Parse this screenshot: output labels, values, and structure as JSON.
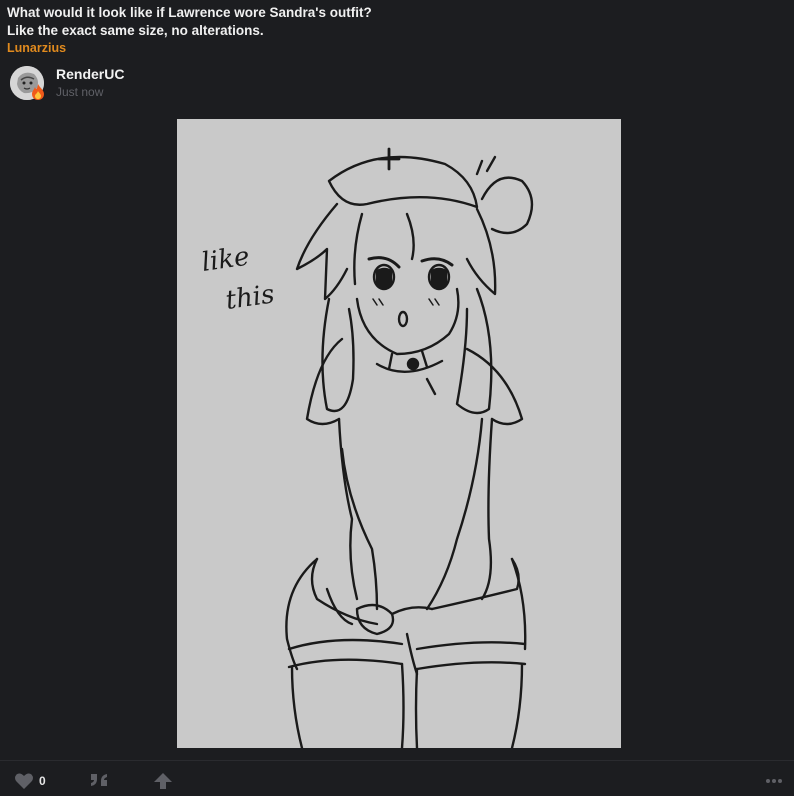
{
  "quote": {
    "line1": "What would it look like if Lawrence wore Sandra's outfit?",
    "line2": "Like the exact same size, no alterations.",
    "author": "Lunarzius"
  },
  "post": {
    "username": "RenderUC",
    "timestamp": "Just now",
    "image_caption_text": [
      "like",
      "this"
    ]
  },
  "actions": {
    "like_count": "0"
  },
  "colors": {
    "background": "#1c1d20",
    "quote_author": "#e08a1e",
    "artwork_bg": "#c9c9c9",
    "muted": "#5f6066"
  },
  "icons": [
    "flame-icon",
    "heart-icon",
    "quote-icon",
    "share-icon",
    "more-icon"
  ]
}
